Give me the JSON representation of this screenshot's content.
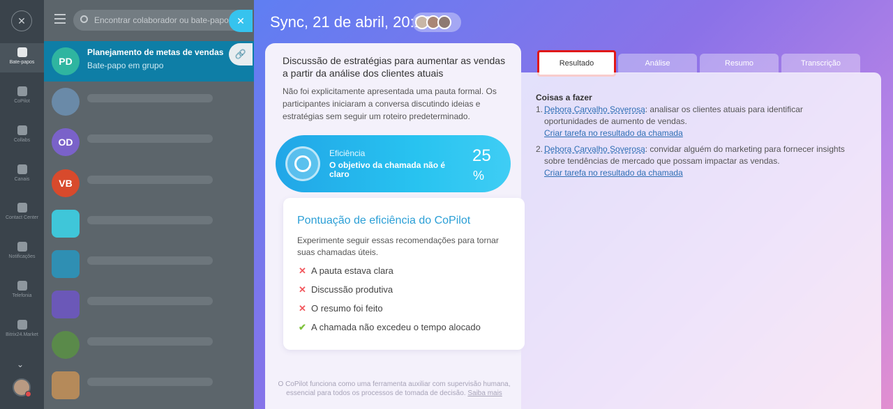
{
  "sidebar": {
    "items": [
      {
        "label": "Bate-papos",
        "icon": "chat-icon",
        "active": true
      },
      {
        "label": "CoPilot",
        "icon": "copilot-icon"
      },
      {
        "label": "Collabs",
        "icon": "collabs-icon"
      },
      {
        "label": "Canais",
        "icon": "channels-icon"
      },
      {
        "label": "Contact Center",
        "icon": "contact-center-icon"
      },
      {
        "label": "Notificações",
        "icon": "bell-icon"
      },
      {
        "label": "Telefonia",
        "icon": "phone-icon"
      },
      {
        "label": "Bitrix24.Market",
        "icon": "market-icon"
      }
    ]
  },
  "chat_list": {
    "search_placeholder": "Encontrar colaborador ou bate-papo",
    "chats": [
      {
        "initials": "PD",
        "name": "Planejamento de metas de vendas",
        "subtitle": "Bate-papo em grupo",
        "color": "#2fb5a0",
        "active": true
      },
      {
        "initials": "",
        "color": "#6a8aa8"
      },
      {
        "initials": "OD",
        "color": "#7a62c9"
      },
      {
        "initials": "VB",
        "color": "#d84a2c"
      },
      {
        "initials": "",
        "color": "#3fc6d9"
      },
      {
        "initials": "",
        "color": "#2f8fb3"
      },
      {
        "initials": "",
        "color": "#6b58b8"
      },
      {
        "initials": "",
        "color": "#5a8a4a"
      },
      {
        "initials": "",
        "color": "#b58a5a"
      }
    ]
  },
  "header": {
    "title": "Sync, 21 de abril, 20:17"
  },
  "summary": {
    "title": "Discussão de estratégias para aumentar as vendas a partir da análise dos clientes atuais",
    "description": "Não foi explicitamente apresentada uma pauta formal. Os participantes iniciaram a conversa discutindo ideias e estratégias sem seguir um roteiro predeterminado."
  },
  "efficiency": {
    "label": "Eficiência",
    "message": "O objetivo da chamada não é claro",
    "score": "25",
    "unit": "%"
  },
  "tip": {
    "title": "Pontuação de eficiência do CoPilot",
    "description": "Experimente seguir essas recomendações para tornar suas chamadas úteis.",
    "criteria": [
      {
        "text": "A pauta estava clara",
        "met": false,
        "mark": "✕"
      },
      {
        "text": "Discussão produtiva",
        "met": false,
        "mark": "✕"
      },
      {
        "text": "O resumo foi feito",
        "met": false,
        "mark": "✕"
      },
      {
        "text": "A chamada não excedeu o tempo alocado",
        "met": true,
        "mark": "✔"
      }
    ]
  },
  "footer": {
    "note": "O CoPilot funciona como uma ferramenta auxiliar com supervisão humana, essencial para todos os processos de tomada de decisão.",
    "link": "Saiba mais"
  },
  "tabs": [
    {
      "label": "Resultado",
      "active": true
    },
    {
      "label": "Análise"
    },
    {
      "label": "Resumo"
    },
    {
      "label": "Transcrição"
    }
  ],
  "result": {
    "heading": "Coisas a fazer",
    "todos": [
      {
        "num": "1.",
        "person": "Debora Carvalho Soverosa",
        "text": ": analisar os clientes atuais para identificar oportunidades de aumento de vendas.",
        "action": "Criar tarefa no resultado da chamada"
      },
      {
        "num": "2.",
        "person": "Debora Carvalho Soverosa",
        "text": ": convidar alguém do marketing para fornecer insights sobre tendências de mercado que possam impactar as vendas.",
        "action": "Criar tarefa no resultado da chamada"
      }
    ]
  }
}
